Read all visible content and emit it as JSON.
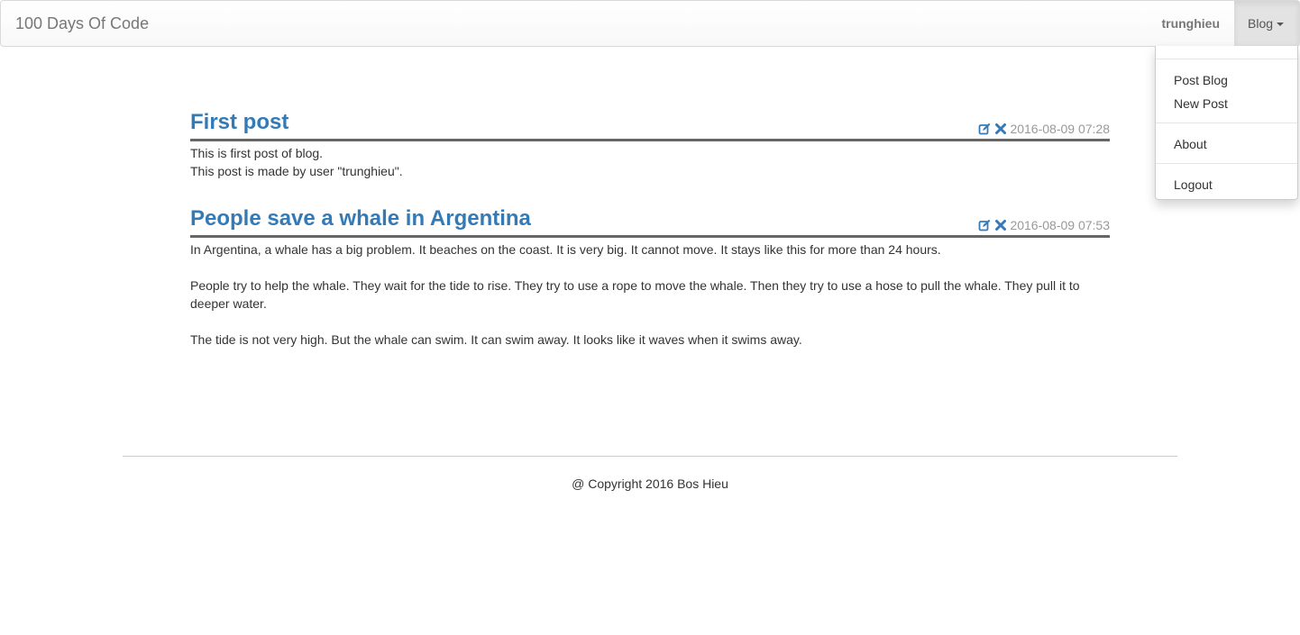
{
  "navbar": {
    "brand": "100 Days Of Code",
    "user": "trunghieu",
    "blog_menu_label": "Blog"
  },
  "dropdown": {
    "items": [
      {
        "label": "Post Blog"
      },
      {
        "label": "New Post"
      },
      {
        "label": "About"
      },
      {
        "label": "Logout"
      }
    ]
  },
  "posts": [
    {
      "title": "First post",
      "timestamp": "2016-08-09 07:28",
      "edit_icon": "edit-icon",
      "delete_icon": "delete-icon",
      "lines": [
        "This is first post of blog.",
        "This post is made by user \"trunghieu\"."
      ]
    },
    {
      "title": "People save a whale in Argentina",
      "timestamp": "2016-08-09 07:53",
      "edit_icon": "edit-icon",
      "delete_icon": "delete-icon",
      "paragraphs": [
        "In Argentina, a whale has a big problem. It beaches on the coast. It is very big. It cannot move. It stays like this for more than 24 hours.",
        "People try to help the whale. They wait for the tide to rise. They try to use a rope to move the whale. Then they try to use a hose to pull the whale. They pull it to deeper water.",
        "The tide is not very high. But the whale can swim. It can swim away. It looks like it waves when it swims away."
      ]
    }
  ],
  "footer": {
    "copyright": "@ Copyright 2016 Bos Hieu"
  },
  "colors": {
    "link": "#337ab7",
    "muted": "#999999",
    "text": "#333333"
  }
}
